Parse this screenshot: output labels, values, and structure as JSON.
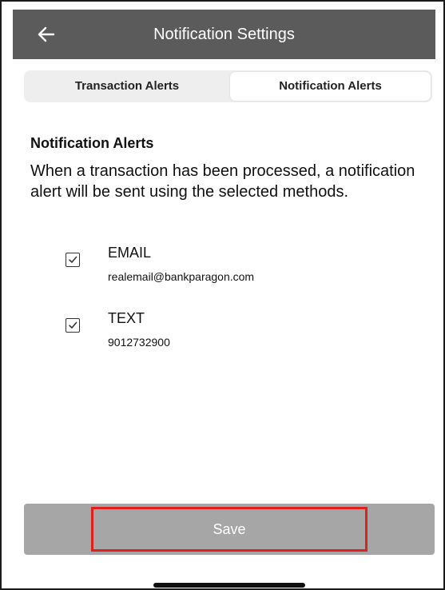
{
  "header": {
    "title": "Notification Settings",
    "back_icon": "arrow-left-icon"
  },
  "tabs": [
    {
      "label": "Transaction Alerts",
      "selected": false
    },
    {
      "label": "Notification Alerts",
      "selected": true
    }
  ],
  "section": {
    "title": "Notification Alerts",
    "description": "When a transaction has been processed, a notification alert will be sent using the selected methods."
  },
  "options": [
    {
      "label": "EMAIL",
      "value": "realemail@bankparagon.com",
      "checked": true,
      "icon": "checkbox-checked-icon"
    },
    {
      "label": "TEXT",
      "value": "9012732900",
      "checked": true,
      "icon": "checkbox-checked-icon"
    }
  ],
  "actions": {
    "save_label": "Save"
  },
  "colors": {
    "header_bg": "#5b5b5b",
    "save_bg": "#a6a6a6",
    "highlight_border": "#e0201e"
  }
}
